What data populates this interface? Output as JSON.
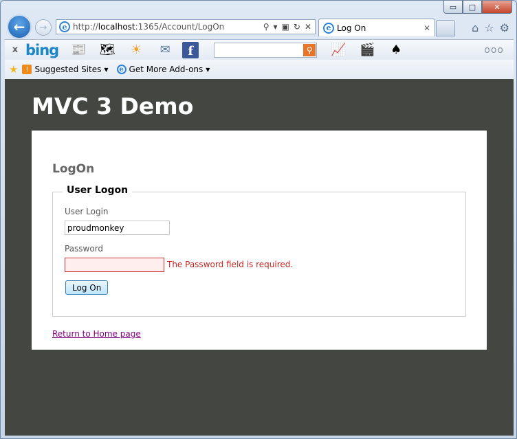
{
  "browser": {
    "address_bar": {
      "url_prefix": "http://",
      "url_host": "localhost",
      "url_rest": ":1365/Account/LogOn"
    },
    "tab": {
      "title": "Log On"
    },
    "icons": {
      "back": "back-arrow-icon",
      "forward": "forward-arrow-icon",
      "home": "home-icon",
      "favorites": "star-icon",
      "tools": "gear-icon"
    },
    "caption_buttons": {
      "minimize": "▭",
      "maximize": "□",
      "close": "✕"
    }
  },
  "bing_toolbar": {
    "logo": "bing",
    "close": "x",
    "more": "ooo"
  },
  "favorites_bar": {
    "items": [
      {
        "label": "Suggested Sites"
      },
      {
        "label": "Get More Add-ons"
      }
    ]
  },
  "page": {
    "site_title": "MVC 3 Demo",
    "heading": "LogOn",
    "form": {
      "legend": "User Logon",
      "login_label": "User Login",
      "login_value": "proudmonkey",
      "password_label": "Password",
      "password_value": "",
      "password_error": "The Password field is required.",
      "submit_label": "Log On"
    },
    "home_link": "Return to Home page"
  },
  "colors": {
    "page_background": "#444641",
    "panel_background": "#ffffff",
    "error": "#cc2222",
    "link_visited": "#800080"
  }
}
